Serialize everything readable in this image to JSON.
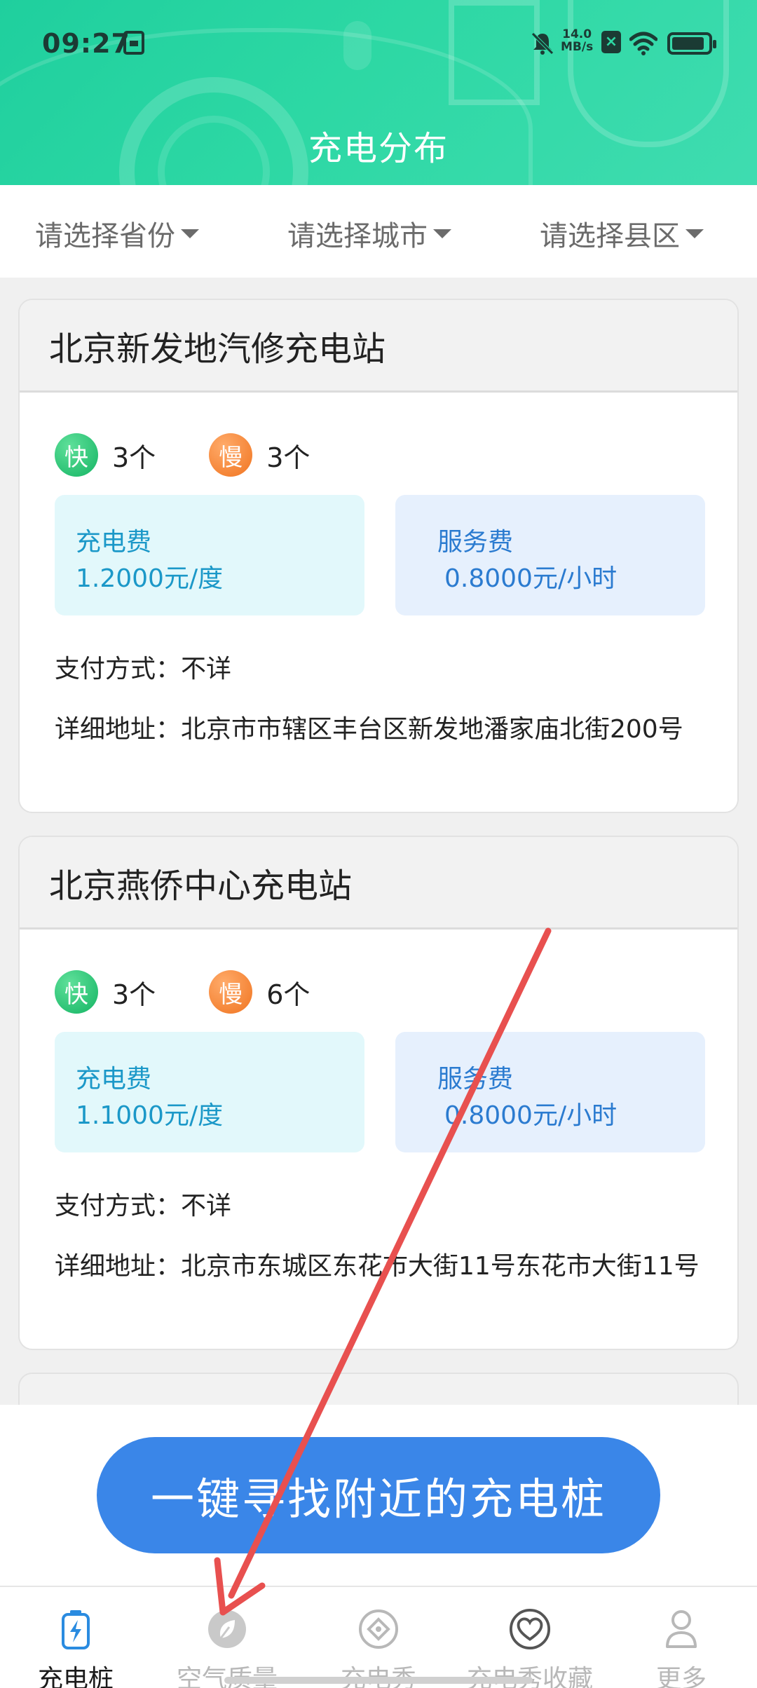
{
  "status_bar": {
    "time": "09:27",
    "net_speed_value": "14.0",
    "net_speed_unit": "MB/s",
    "battery_level": 0.9
  },
  "header": {
    "title": "充电分布"
  },
  "filters": {
    "province": "请选择省份",
    "city": "请选择城市",
    "county": "请选择县区"
  },
  "stations": [
    {
      "name": "北京新发地汽修充电站",
      "fast_badge": "快",
      "fast_count": "3个",
      "slow_badge": "慢",
      "slow_count": "3个",
      "charge_fee_label": "充电费",
      "charge_fee": "1.2000元/度",
      "service_fee_label": "服务费",
      "service_fee": "0.8000元/小时",
      "payment": "支付方式：不详",
      "address": "详细地址：北京市市辖区丰台区新发地潘家庙北街200号"
    },
    {
      "name": "北京燕侨中心充电站",
      "fast_badge": "快",
      "fast_count": "3个",
      "slow_badge": "慢",
      "slow_count": "6个",
      "charge_fee_label": "充电费",
      "charge_fee": "1.1000元/度",
      "service_fee_label": "服务费",
      "service_fee": "0.8000元/小时",
      "payment": "支付方式：不详",
      "address": "详细地址：北京市东城区东花市大街11号东花市大街11号"
    }
  ],
  "cta": {
    "label": "一键寻找附近的充电桩"
  },
  "nav": {
    "items": [
      {
        "label": "充电桩",
        "icon": "charging-pile-icon",
        "active": true
      },
      {
        "label": "空气质量",
        "icon": "leaf-icon",
        "active": false
      },
      {
        "label": "充电秀",
        "icon": "diamond-icon",
        "active": false
      },
      {
        "label": "充电秀收藏",
        "icon": "heart-icon",
        "active": false
      },
      {
        "label": "更多",
        "icon": "person-icon",
        "active": false
      }
    ]
  },
  "colors": {
    "header_green": "#2dd8a4",
    "cta_blue": "#3a86e8",
    "fast_green": "#14b463",
    "slow_orange": "#f07420",
    "annotation_red": "#e8504f"
  }
}
